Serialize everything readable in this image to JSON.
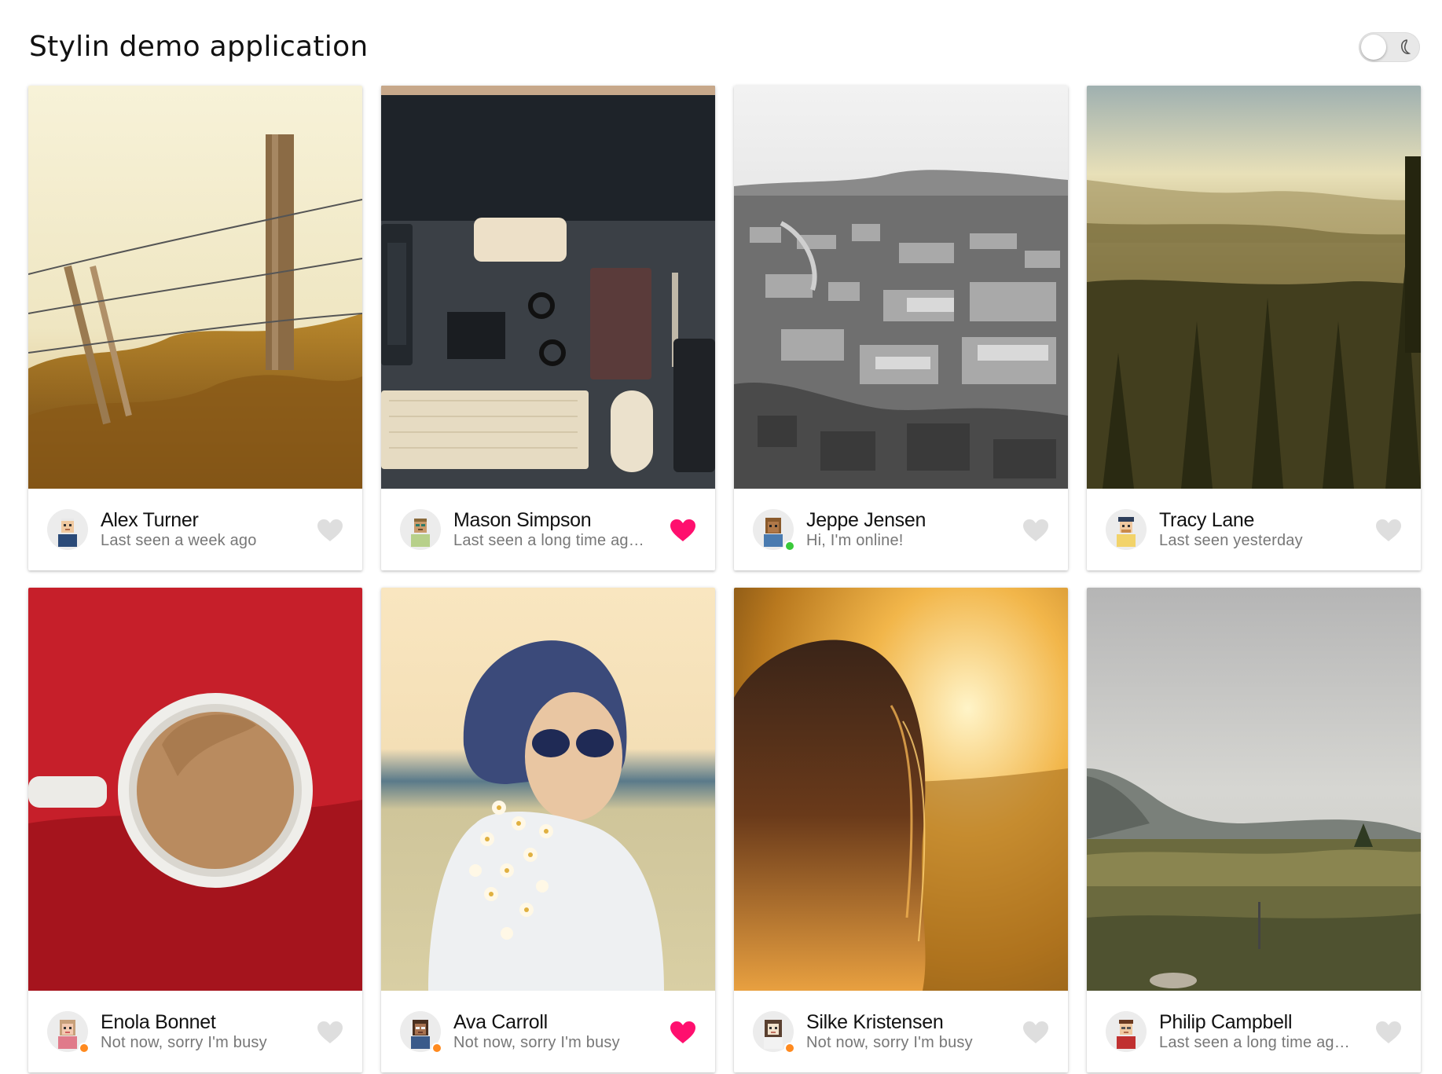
{
  "app": {
    "title": "Stylin demo application"
  },
  "theme_toggle": {
    "state": "off",
    "icon": "moon-icon"
  },
  "colors": {
    "liked": "#ff0f6e",
    "unliked": "#dedede",
    "online": "#3ac93a",
    "busy": "#ff8a1f"
  },
  "cards": [
    {
      "name": "Alex Turner",
      "status": "Last seen a week ago",
      "liked": false,
      "presence": "none",
      "photo": "fence-field"
    },
    {
      "name": "Mason Simpson",
      "status": "Last seen a long time ago...",
      "liked": true,
      "presence": "none",
      "photo": "desk-workspace"
    },
    {
      "name": "Jeppe Jensen",
      "status": "Hi, I'm online!",
      "liked": false,
      "presence": "online",
      "photo": "city-aerial-bw"
    },
    {
      "name": "Tracy Lane",
      "status": "Last seen yesterday",
      "liked": false,
      "presence": "none",
      "photo": "hazy-valley"
    },
    {
      "name": "Enola Bonnet",
      "status": "Not now, sorry I'm busy",
      "liked": false,
      "presence": "busy",
      "photo": "coffee-cup-red"
    },
    {
      "name": "Ava Carroll",
      "status": "Not now, sorry I'm busy",
      "liked": true,
      "presence": "busy",
      "photo": "woman-sunglasses-flowers"
    },
    {
      "name": "Silke Kristensen",
      "status": "Not now, sorry I'm busy",
      "liked": false,
      "presence": "busy",
      "photo": "hair-sunset"
    },
    {
      "name": "Philip Campbell",
      "status": "Last seen a long time ago...",
      "liked": false,
      "presence": "none",
      "photo": "mountain-plain-cloudy"
    }
  ]
}
